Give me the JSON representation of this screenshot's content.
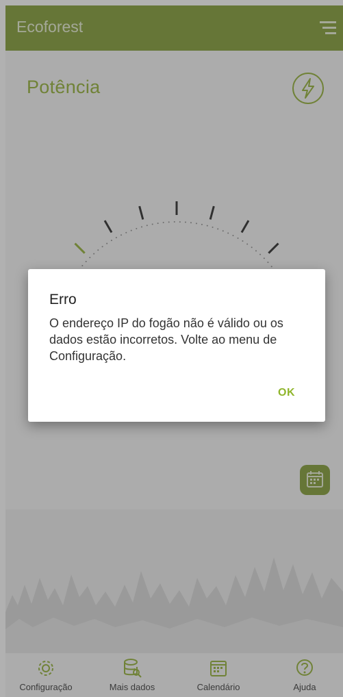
{
  "app": {
    "title": "Ecoforest"
  },
  "section": {
    "title": "Potência"
  },
  "icons": {
    "menu": "menu-icon",
    "power": "lightning-bolt-icon",
    "calendar_button": "calendar-icon"
  },
  "bottom_nav": [
    {
      "label": "Configuração",
      "icon": "gear-icon"
    },
    {
      "label": "Mais dados",
      "icon": "database-search-icon"
    },
    {
      "label": "Calendário",
      "icon": "calendar-icon"
    },
    {
      "label": "Ajuda",
      "icon": "help-icon"
    }
  ],
  "dialog": {
    "title": "Erro",
    "message": "O endereço IP do fogão não é válido ou os dados estão incorretos. Volte ao menu de Configuração.",
    "ok": "OK"
  },
  "colors": {
    "appbar": "#7f9a2e",
    "accent": "#8fae2e",
    "button_text": "#8fb52b",
    "scrim": "rgba(70,70,70,0.42)"
  }
}
